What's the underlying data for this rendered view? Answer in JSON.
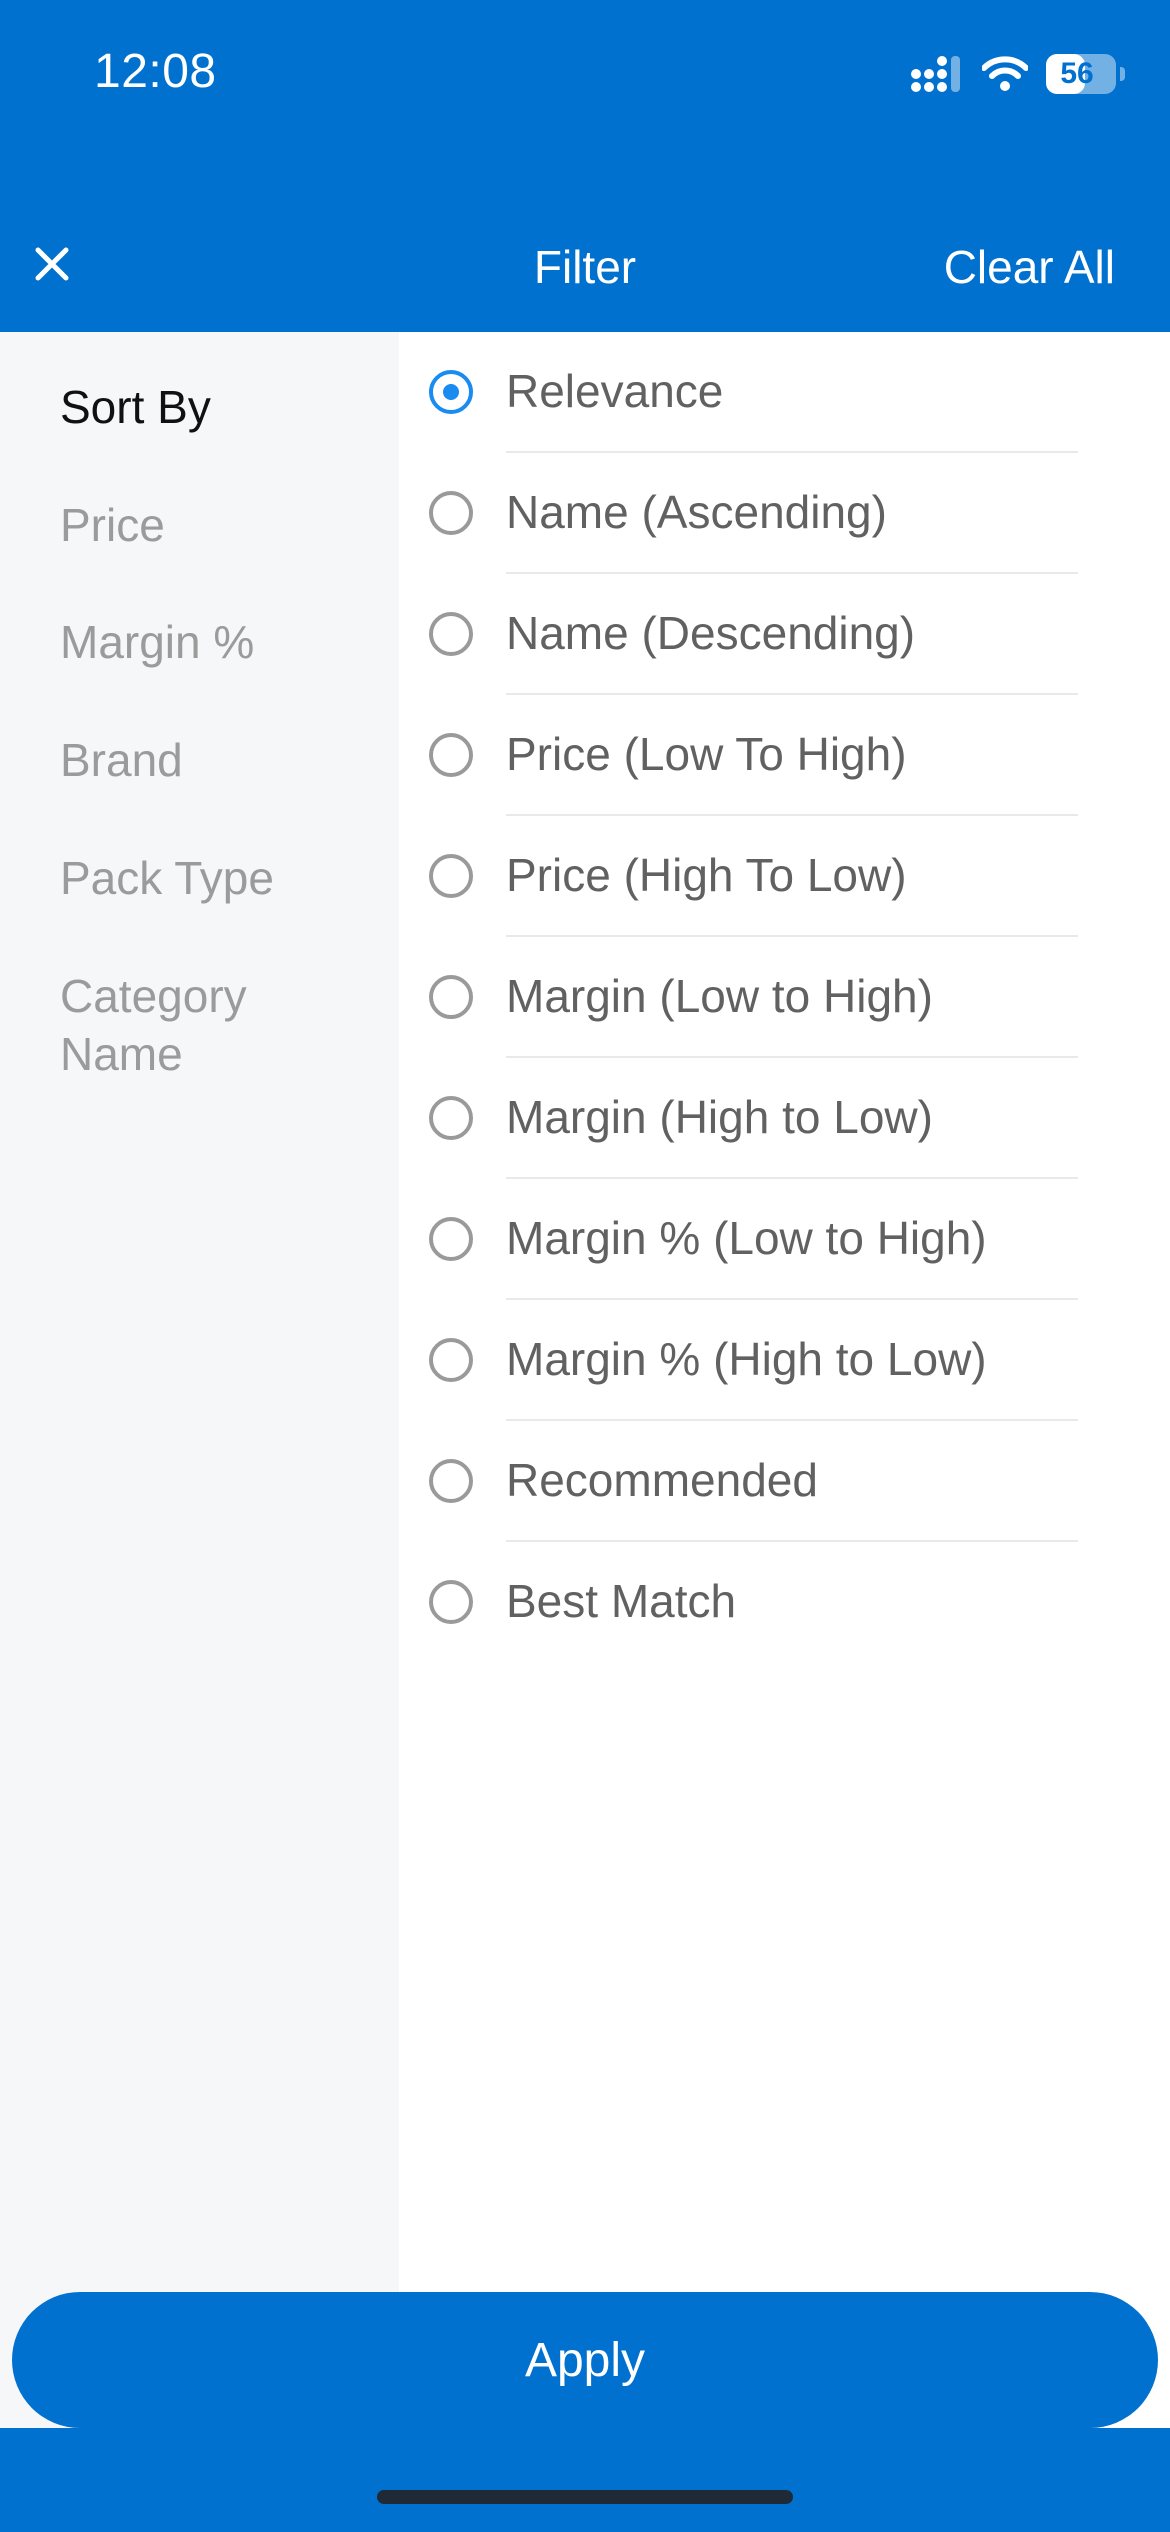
{
  "status_bar": {
    "time": "12:08",
    "battery_level": "56",
    "battery_fraction": 0.56,
    "icons": [
      "cellular-signal-icon",
      "wifi-icon",
      "battery-icon"
    ]
  },
  "header": {
    "title": "Filter",
    "clear_all_label": "Clear All",
    "close_icon": "close-icon"
  },
  "sidebar": {
    "items": [
      {
        "label": "Sort By",
        "active": true
      },
      {
        "label": "Price",
        "active": false
      },
      {
        "label": "Margin %",
        "active": false
      },
      {
        "label": "Brand",
        "active": false
      },
      {
        "label": "Pack Type",
        "active": false
      },
      {
        "label": "Category Name",
        "active": false
      }
    ]
  },
  "sort_options": {
    "selected": "Relevance",
    "items": [
      {
        "label": "Relevance"
      },
      {
        "label": "Name (Ascending)"
      },
      {
        "label": "Name (Descending)"
      },
      {
        "label": "Price (Low To High)"
      },
      {
        "label": "Price (High To Low)"
      },
      {
        "label": "Margin (Low to High)"
      },
      {
        "label": "Margin (High to Low)"
      },
      {
        "label": "Margin % (Low to High)"
      },
      {
        "label": "Margin % (High to Low)"
      },
      {
        "label": "Recommended"
      },
      {
        "label": "Best Match"
      }
    ]
  },
  "footer": {
    "apply_label": "Apply"
  },
  "colors": {
    "brand_blue": "#0171CF",
    "radio_selected": "#1A8BF0",
    "sidebar_bg": "#F6F7F9"
  }
}
